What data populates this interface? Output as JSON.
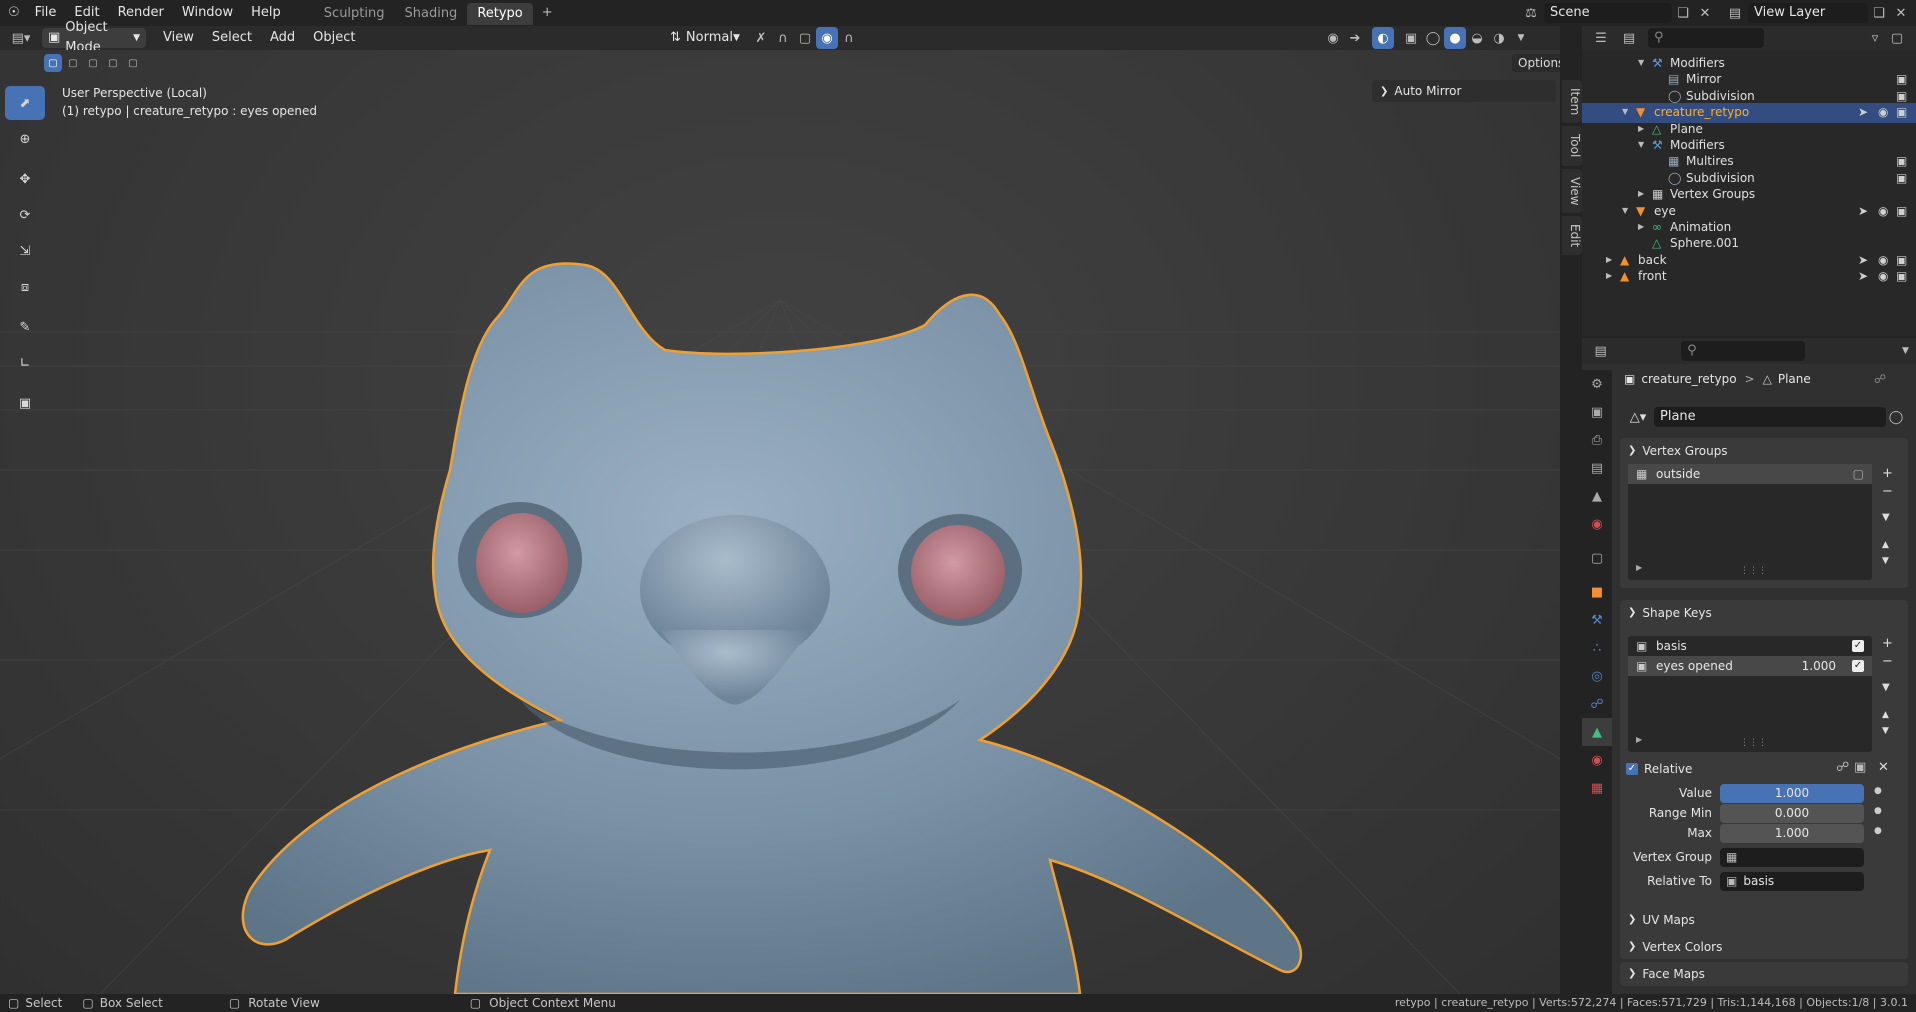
{
  "menu": {
    "items": [
      "File",
      "Edit",
      "Render",
      "Window",
      "Help"
    ]
  },
  "workspaces": {
    "tabs": [
      "Sculpting",
      "Shading",
      "Retypo"
    ],
    "active": "Retypo",
    "add": "+"
  },
  "scene": {
    "name": "Scene",
    "view_layer": "View Layer"
  },
  "viewport_header": {
    "mode": "Object Mode",
    "menus": [
      "View",
      "Select",
      "Add",
      "Object"
    ],
    "orientation": "Normal",
    "options": "Options"
  },
  "viewport": {
    "perspective": "User Perspective (Local)",
    "object_info": "(1) retypo | creature_retypo : eyes opened",
    "auto_mirror": "Auto Mirror"
  },
  "sidebar_tabs": [
    "Item",
    "Tool",
    "View",
    "Edit"
  ],
  "outliner": {
    "rows": [
      {
        "label": "Modifiers",
        "indent": 3,
        "icon": "wrench-icon"
      },
      {
        "label": "Mirror",
        "indent": 4,
        "icon": "mirror-icon"
      },
      {
        "label": "Subdivision",
        "indent": 4,
        "icon": "subdivision-icon"
      },
      {
        "label": "creature_retypo",
        "indent": 2,
        "icon": "mesh-object-icon",
        "selected": true
      },
      {
        "label": "Plane",
        "indent": 3,
        "icon": "mesh-data-icon"
      },
      {
        "label": "Modifiers",
        "indent": 3,
        "icon": "wrench-icon"
      },
      {
        "label": "Multires",
        "indent": 4,
        "icon": "multires-icon"
      },
      {
        "label": "Subdivision",
        "indent": 4,
        "icon": "subdivision-icon"
      },
      {
        "label": "Vertex Groups",
        "indent": 3,
        "icon": "vertex-groups-icon"
      },
      {
        "label": "eye",
        "indent": 2,
        "icon": "mesh-object-icon"
      },
      {
        "label": "Animation",
        "indent": 3,
        "icon": "animation-icon"
      },
      {
        "label": "Sphere.001",
        "indent": 3,
        "icon": "mesh-data-icon"
      },
      {
        "label": "back",
        "indent": 1,
        "icon": "image-empty-icon"
      },
      {
        "label": "front",
        "indent": 1,
        "icon": "image-empty-icon"
      }
    ]
  },
  "properties": {
    "breadcrumb_object": "creature_retypo",
    "breadcrumb_sep": ">",
    "breadcrumb_data": "Plane",
    "mesh_name": "Plane",
    "vertex_groups": {
      "title": "Vertex Groups",
      "items": [
        "outside"
      ]
    },
    "shape_keys": {
      "title": "Shape Keys",
      "items": [
        {
          "name": "basis",
          "value": ""
        },
        {
          "name": "eyes opened",
          "value": "1.000"
        }
      ],
      "relative_label": "Relative",
      "value_label": "Value",
      "value": "1.000",
      "range_min_label": "Range Min",
      "range_min": "0.000",
      "max_label": "Max",
      "max": "1.000",
      "vertex_group_label": "Vertex Group",
      "vertex_group": "",
      "relative_to_label": "Relative To",
      "relative_to": "basis"
    },
    "collapsed": [
      "UV Maps",
      "Vertex Colors",
      "Face Maps"
    ]
  },
  "status": {
    "select": "Select",
    "box_select": "Box Select",
    "rotate": "Rotate View",
    "context": "Object Context Menu",
    "stats": "retypo | creature_retypo | Verts:572,274 | Faces:571,729 | Tris:1,144,168 | Objects:1/8 | 3.0.1"
  },
  "colors": {
    "accent": "#4772b3",
    "selection_outline": "#f0a030",
    "creature_body": "#7a91a6",
    "creature_eye": "#b0707a"
  }
}
